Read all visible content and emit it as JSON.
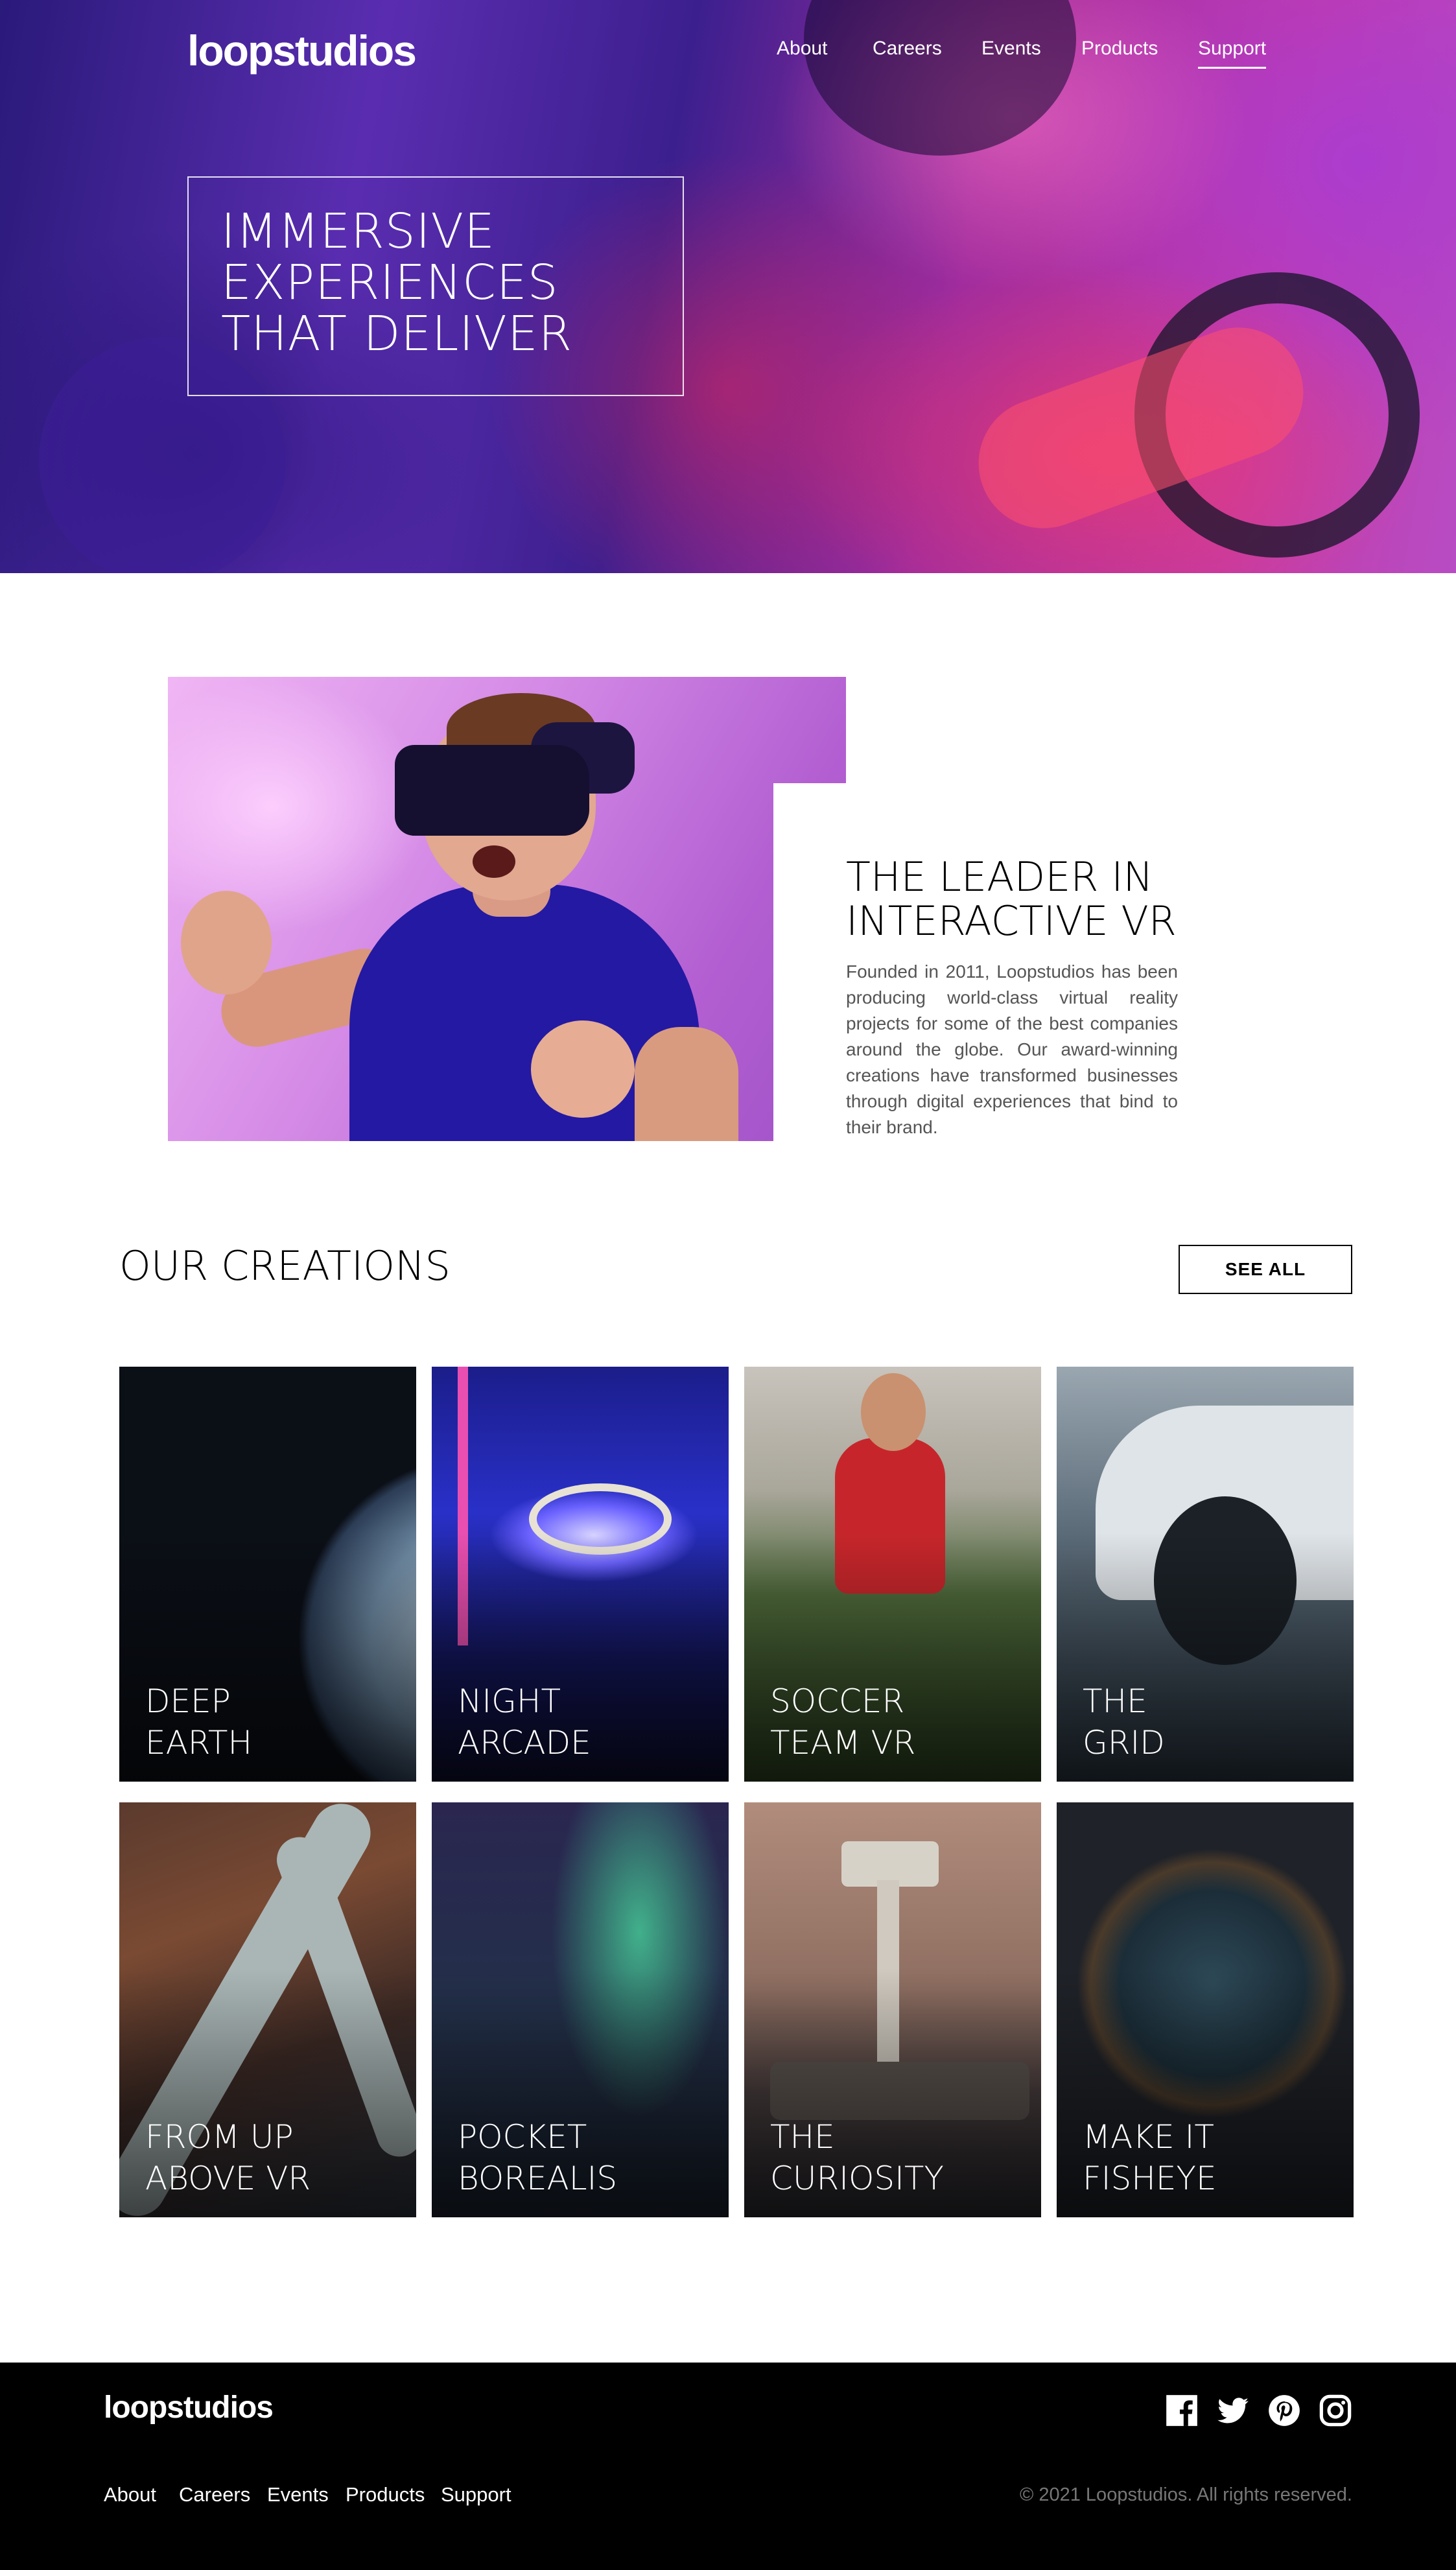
{
  "header": {
    "logo": "loopstudios",
    "nav": [
      {
        "label": "About"
      },
      {
        "label": "Careers"
      },
      {
        "label": "Events"
      },
      {
        "label": "Products"
      },
      {
        "label": "Support"
      }
    ],
    "active_nav": "Support"
  },
  "hero": {
    "lines": [
      "IMMERSIVE",
      "EXPERIENCES",
      "THAT DELIVER"
    ]
  },
  "about": {
    "title_lines": [
      "THE LEADER IN",
      "INTERACTIVE VR"
    ],
    "text": "Founded in 2011, Loopstudios has been producing world-class virtual reality projects for some of the best companies around the globe. Our award-winning creations have transformed businesses through digital experiences that bind to their brand."
  },
  "creations": {
    "title": "OUR CREATIONS",
    "see_all_label": "SEE ALL",
    "cards": [
      {
        "title": "DEEP\nEARTH"
      },
      {
        "title": "NIGHT\nARCADE"
      },
      {
        "title": "SOCCER\nTEAM VR"
      },
      {
        "title": "THE\nGRID"
      },
      {
        "title": "FROM UP\nABOVE VR"
      },
      {
        "title": "POCKET\nBOREALIS"
      },
      {
        "title": "THE\nCURIOSITY"
      },
      {
        "title": "MAKE IT\nFISHEYE"
      }
    ]
  },
  "footer": {
    "logo": "loopstudios",
    "nav": [
      {
        "label": "About"
      },
      {
        "label": "Careers"
      },
      {
        "label": "Events"
      },
      {
        "label": "Products"
      },
      {
        "label": "Support"
      }
    ],
    "social_icons": [
      "facebook-icon",
      "twitter-icon",
      "pinterest-icon",
      "instagram-icon"
    ],
    "copyright": "© 2021 Loopstudios. All rights reserved."
  },
  "colors": {
    "footer_bg": "#000000",
    "copyright": "#777777",
    "body_text": "#555555"
  }
}
